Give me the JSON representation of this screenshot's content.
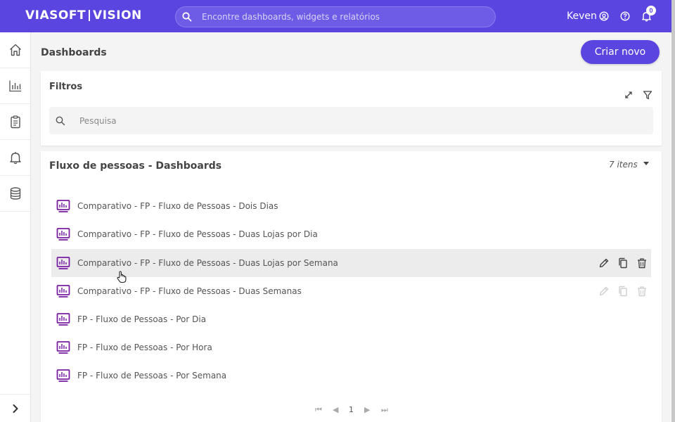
{
  "app": {
    "brand_left": "VIASOFT",
    "brand_right": "VISION",
    "search_placeholder": "Encontre dashboards, widgets e relatórios",
    "user_name": "Keven",
    "notification_count": "0",
    "accent_color": "#5b45e0"
  },
  "sidebar": {
    "items": [
      {
        "icon": "home-icon"
      },
      {
        "icon": "chart-icon"
      },
      {
        "icon": "clipboard-icon"
      },
      {
        "icon": "bell-icon"
      },
      {
        "icon": "database-icon"
      }
    ],
    "expand_icon": "chevron-right-icon"
  },
  "header": {
    "title": "Dashboards",
    "create_label": "Criar novo"
  },
  "filters": {
    "title": "Filtros",
    "search_placeholder": "Pesquisa"
  },
  "group": {
    "title": "Fluxo de pessoas - Dashboards",
    "count": "7 itens",
    "items": [
      {
        "label": "Comparativo - FP - Fluxo de Pessoas - Dois Dias",
        "state": "normal"
      },
      {
        "label": "Comparativo - FP - Fluxo de Pessoas - Duas Lojas por Dia",
        "state": "normal"
      },
      {
        "label": "Comparativo - FP - Fluxo de Pessoas - Duas Lojas por Semana",
        "state": "hover"
      },
      {
        "label": "Comparativo - FP - Fluxo de Pessoas - Duas Semanas",
        "state": "fading"
      },
      {
        "label": "FP - Fluxo de Pessoas - Por Dia",
        "state": "normal"
      },
      {
        "label": "FP - Fluxo de Pessoas - Por Hora",
        "state": "normal"
      },
      {
        "label": "FP - Fluxo de Pessoas - Por Semana",
        "state": "normal"
      }
    ]
  },
  "pagination": {
    "current_page": "1"
  }
}
